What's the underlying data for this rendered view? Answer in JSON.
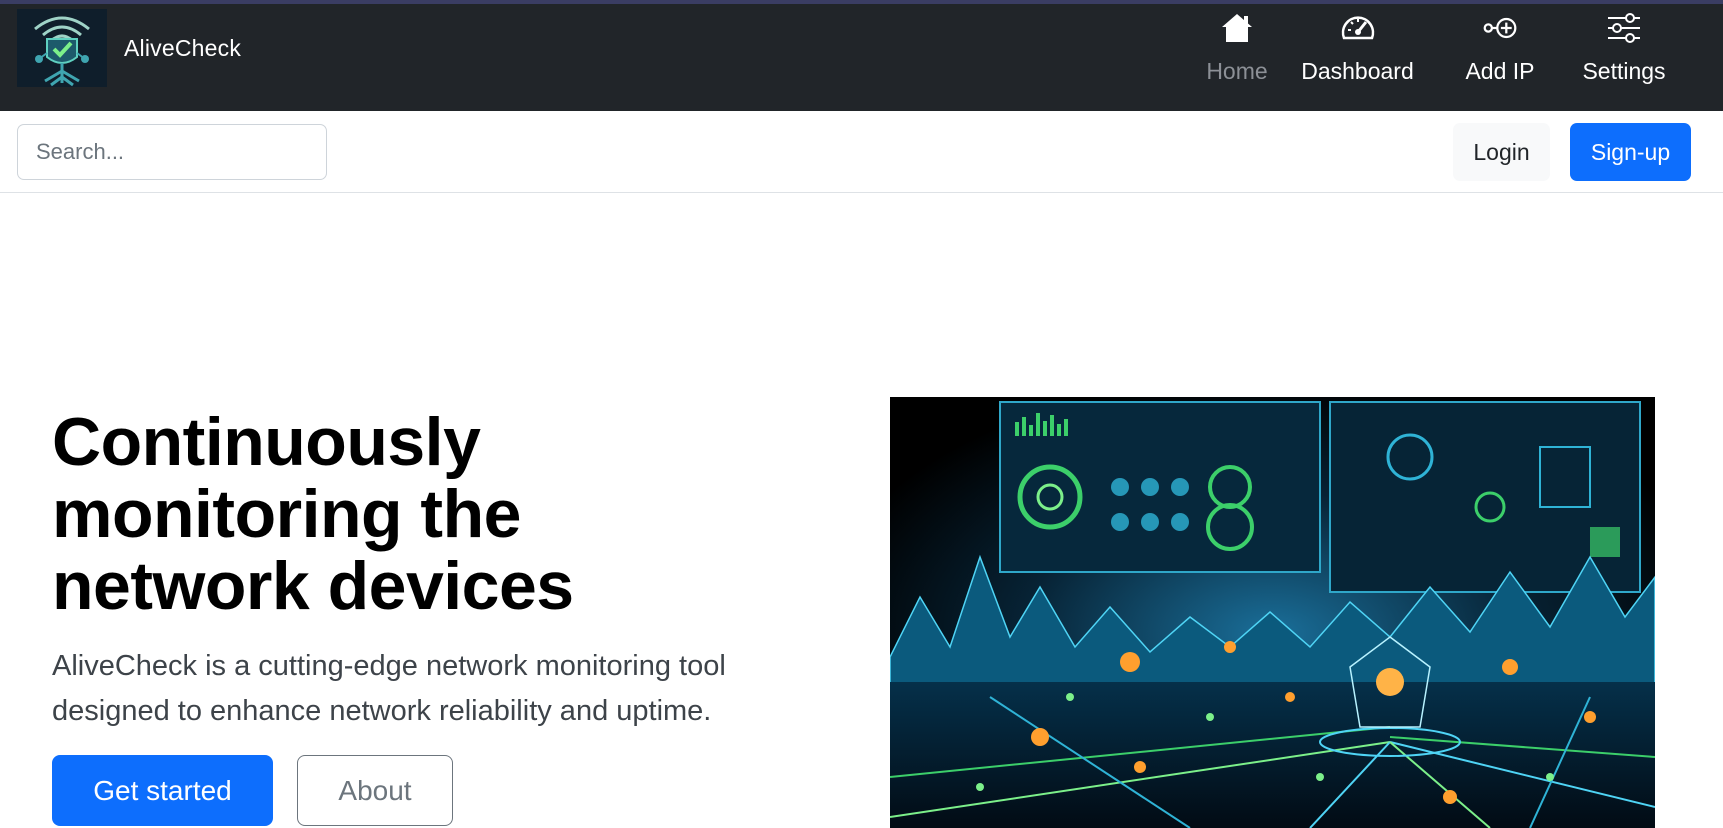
{
  "app": {
    "brand_name": "AliveCheck",
    "logo_icon": "heartbeat-tree-shield-logo"
  },
  "nav": {
    "items": [
      {
        "label": "Home",
        "icon": "house-icon",
        "active": true
      },
      {
        "label": "Dashboard",
        "icon": "speedometer-icon",
        "active": false
      },
      {
        "label": "Add IP",
        "icon": "node-plus-icon",
        "active": false
      },
      {
        "label": "Settings",
        "icon": "sliders-icon",
        "active": false
      }
    ]
  },
  "toolbar": {
    "search_placeholder": "Search...",
    "login_label": "Login",
    "signup_label": "Sign-up"
  },
  "hero": {
    "title": "Continuously monitoring the network devices",
    "lead": "AliveCheck is a cutting-edge network monitoring tool designed to enhance network reliability and uptime.",
    "primary_button": "Get started",
    "secondary_button": "About",
    "image_subject": "futuristic-network-monitoring-illustration"
  },
  "colors": {
    "navbar_bg": "#212529",
    "primary": "#0d6efd",
    "nav_active": "#8c9096",
    "light_button": "#f8f9fa"
  }
}
